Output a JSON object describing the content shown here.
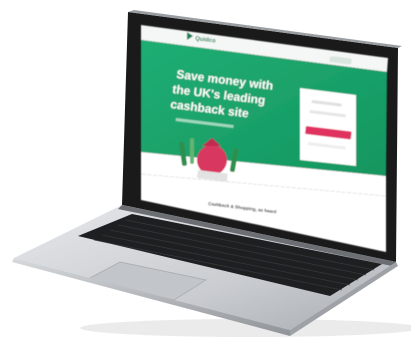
{
  "image": {
    "description": "Laptop with website on screen",
    "colors": {
      "brand_green": "#1fa06c",
      "dark_green": "#138a58",
      "accent_pink": "#e0305e",
      "laptop_silver": "#cfd2d6",
      "screen_black": "#111111"
    }
  },
  "site": {
    "logo": "Quidco",
    "headline_line1": "Save money with",
    "headline_line2": "the UK's leading",
    "headline_line3": "cashback site",
    "section_title": "Cashback & Shopping, as heard"
  }
}
